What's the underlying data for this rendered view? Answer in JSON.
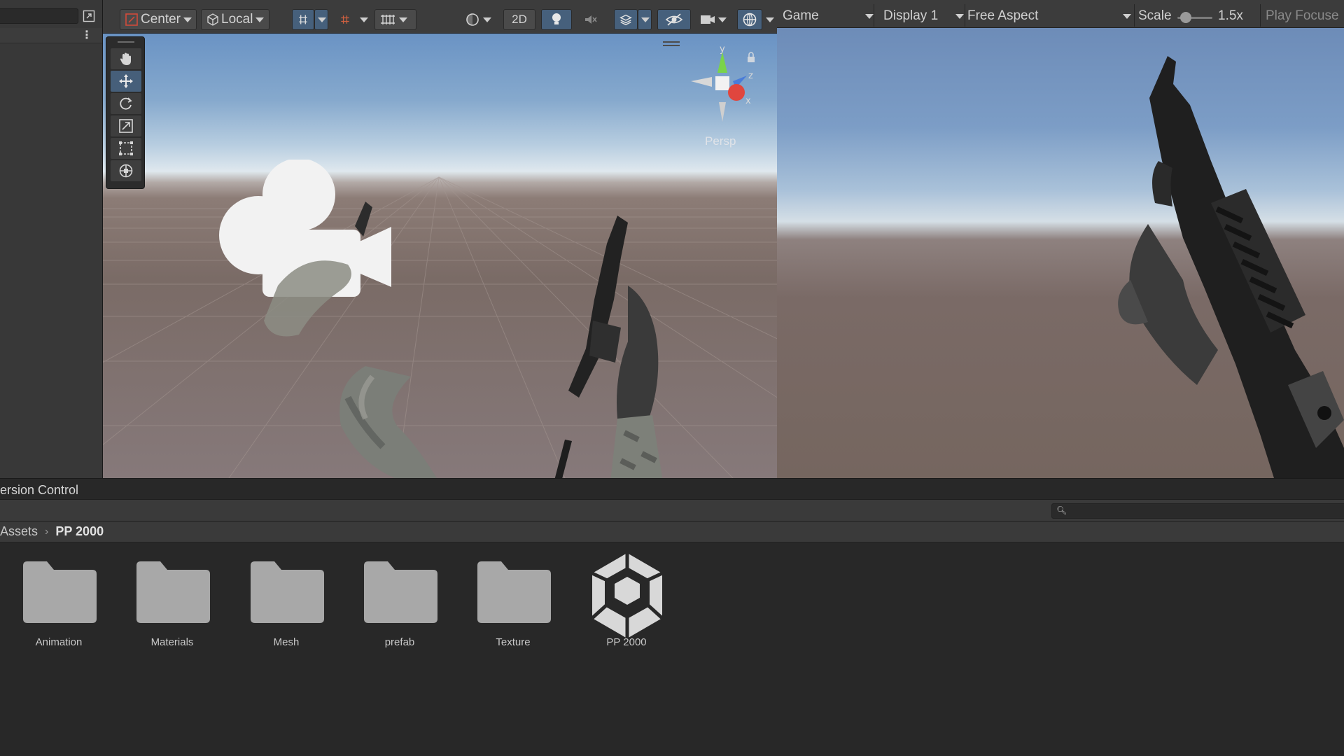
{
  "scene": {
    "pivot_label": "Center",
    "space_label": "Local",
    "two_d_label": "2D",
    "persp_label": "Persp",
    "gizmo_axes": {
      "y": "y",
      "z": "z",
      "x": "x"
    }
  },
  "game": {
    "view_dropdown": "Game",
    "display_dropdown": "Display 1",
    "aspect_dropdown": "Free Aspect",
    "scale_label": "Scale",
    "scale_value": "1.5x",
    "play_mode_label": "Play Focuse"
  },
  "project": {
    "tab_label": "ersion Control",
    "breadcrumb": {
      "root": "Assets",
      "current": "PP 2000"
    },
    "items": [
      {
        "label": "Animation",
        "kind": "folder"
      },
      {
        "label": "Materials",
        "kind": "folder"
      },
      {
        "label": "Mesh",
        "kind": "folder"
      },
      {
        "label": "prefab",
        "kind": "folder"
      },
      {
        "label": "Texture",
        "kind": "folder"
      },
      {
        "label": "PP 2000",
        "kind": "unity-prefab"
      }
    ]
  },
  "colors": {
    "panel_bg": "#282828",
    "toolbar_bg": "#3c3c3c",
    "active_button": "#46607c",
    "folder": "#a8a8a8"
  }
}
